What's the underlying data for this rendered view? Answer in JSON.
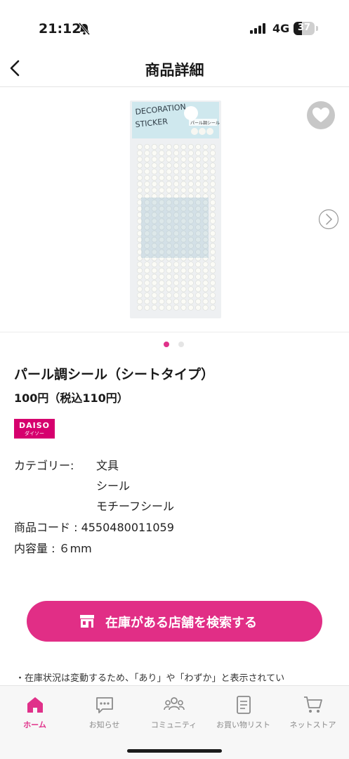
{
  "status_bar": {
    "time": "21:12",
    "network": "4G",
    "battery": "37"
  },
  "header": {
    "title": "商品詳細"
  },
  "gallery": {
    "page_count": 2,
    "current_page": 1
  },
  "package": {
    "line1": "DECORATION",
    "line2": "STICKER",
    "label": "パール調シール"
  },
  "product": {
    "name": "パール調シール（シートタイプ）",
    "price": "100円（税込110円）",
    "brand_logo_text": "DAISO",
    "brand_logo_sub": "ダイソー"
  },
  "details": {
    "category_label": "カテゴリー:",
    "categories": [
      "文具",
      "シール",
      "モチーフシール"
    ],
    "code": "商品コード : 4550480011059",
    "capacity": "内容量 : ６mm"
  },
  "cta": {
    "label": "在庫がある店舗を検索する"
  },
  "note": "・在庫状況は変動するため、「あり」や「わずか」と表示されてい",
  "tabs": [
    {
      "label": "ホーム",
      "icon": "home-icon",
      "active": true
    },
    {
      "label": "お知らせ",
      "icon": "chat-icon",
      "active": false
    },
    {
      "label": "コミュニティ",
      "icon": "community-icon",
      "active": false
    },
    {
      "label": "お買い物リスト",
      "icon": "list-icon",
      "active": false
    },
    {
      "label": "ネットストア",
      "icon": "cart-icon",
      "active": false
    }
  ],
  "colors": {
    "accent": "#e12e86",
    "brand": "#d6006e"
  }
}
